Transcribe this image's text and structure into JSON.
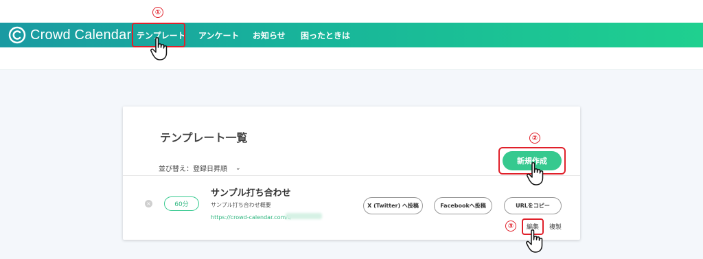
{
  "header": {
    "brand": "Crowd Calendar",
    "nav": [
      {
        "label": "テンプレート"
      },
      {
        "label": "アンケート"
      },
      {
        "label": "お知らせ"
      },
      {
        "label": "困ったときは"
      }
    ]
  },
  "main": {
    "title": "テンプレート一覧",
    "sort_label": "並び替え：登録日昇順",
    "sort_chevron": "⌄",
    "new_button": "新規作成",
    "template": {
      "remove_icon": "×",
      "duration": "60分",
      "name": "サンプル打ち合わせ",
      "description": "サンプル打ち合わせ概要",
      "url": "https://crowd-calendar.com/t/",
      "actions": {
        "x_post": "X (Twitter) へ投稿",
        "facebook_post": "Facebookへ投稿",
        "copy_url": "URLをコピー",
        "edit": "編集",
        "duplicate": "複製"
      }
    }
  },
  "annotations": {
    "step1": "①",
    "step2": "②",
    "step3": "③"
  },
  "colors": {
    "accent": "#36c98f",
    "header_start": "#1a9aa2",
    "header_end": "#1fd08f",
    "annotation_red": "#e0202a"
  }
}
